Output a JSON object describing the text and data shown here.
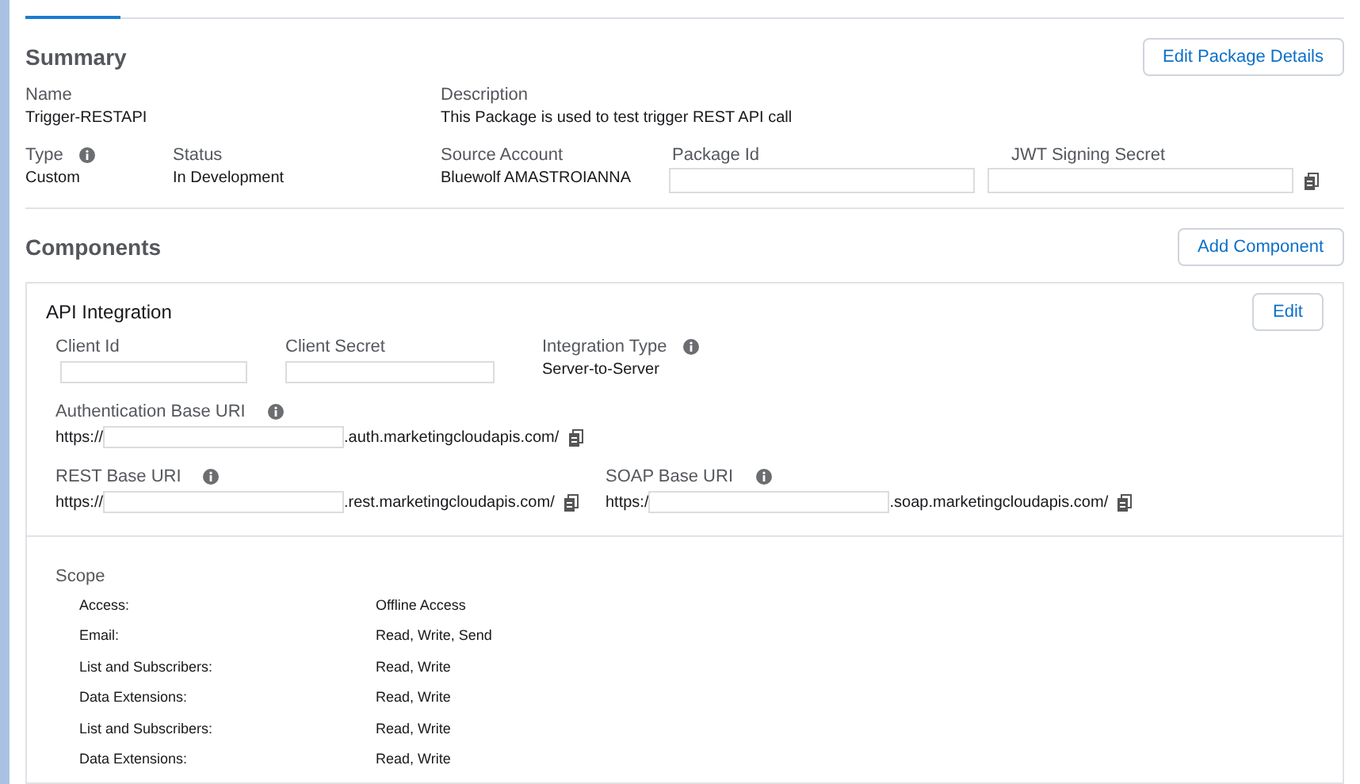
{
  "summary": {
    "title": "Summary",
    "edit_button": "Edit Package Details",
    "name": {
      "label": "Name",
      "value": "Trigger-RESTAPI"
    },
    "description": {
      "label": "Description",
      "value": "This Package is used to test trigger REST API call"
    },
    "type": {
      "label": "Type",
      "value": "Custom"
    },
    "status": {
      "label": "Status",
      "value": "In Development"
    },
    "source_account": {
      "label": "Source Account",
      "value": "Bluewolf AMASTROIANNA"
    },
    "package_id": {
      "label": "Package Id"
    },
    "jwt_signing_secret": {
      "label": "JWT Signing Secret"
    }
  },
  "components": {
    "title": "Components",
    "add_button": "Add Component",
    "card": {
      "title": "API Integration",
      "edit_button": "Edit",
      "client_id": {
        "label": "Client Id"
      },
      "client_secret": {
        "label": "Client Secret"
      },
      "integration_type": {
        "label": "Integration Type",
        "value": "Server-to-Server"
      },
      "auth_uri": {
        "label": "Authentication Base URI",
        "prefix": "https://",
        "suffix": ".auth.marketingcloudapis.com/"
      },
      "rest_uri": {
        "label": "REST Base URI",
        "prefix": "https://",
        "suffix": ".rest.marketingcloudapis.com/"
      },
      "soap_uri": {
        "label": "SOAP Base URI",
        "prefix": "https:/",
        "suffix": ".soap.marketingcloudapis.com/"
      },
      "scope": {
        "title": "Scope",
        "rows": [
          {
            "name": "Access:",
            "value": "Offline Access"
          },
          {
            "name": "Email:",
            "value": "Read, Write, Send"
          },
          {
            "name": "List and Subscribers:",
            "value": "Read, Write"
          },
          {
            "name": "Data Extensions:",
            "value": "Read, Write"
          },
          {
            "name": "List and Subscribers:",
            "value": "Read, Write"
          },
          {
            "name": "Data Extensions:",
            "value": "Read, Write"
          }
        ]
      }
    }
  }
}
